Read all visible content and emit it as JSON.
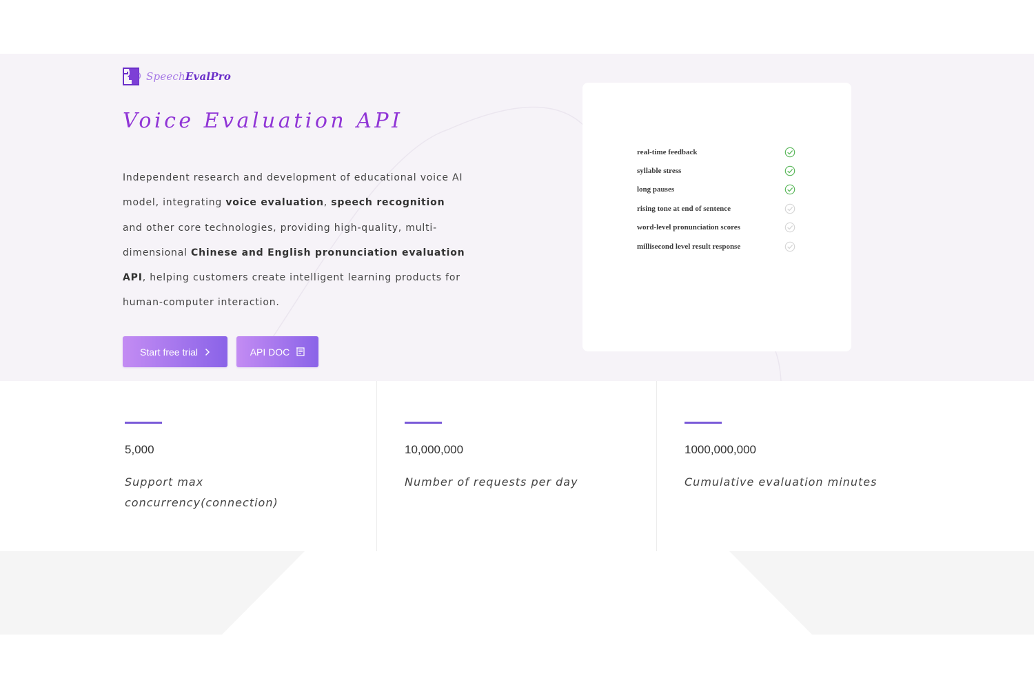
{
  "brand": {
    "name_part1": "Speech",
    "name_part2": "EvalPro",
    "logo_icon": "speaker-head-icon"
  },
  "hero": {
    "title": "Voice Evaluation API",
    "description": {
      "t1": "Independent research and development of educational voice AI model, integrating ",
      "b1": "voice evaluation",
      "t2": ", ",
      "b2": "speech recognition",
      "t3": " and other core technologies, providing high-quality, multi-dimensional ",
      "b3": "Chinese and English pronunciation evaluation API",
      "t4": ", helping customers create intelligent learning products for human-computer interaction."
    },
    "buttons": {
      "trial_label": "Start free trial",
      "trial_icon": "chevron-right-icon",
      "doc_label": "API DOC",
      "doc_icon": "document-icon"
    }
  },
  "features": [
    {
      "label": "real-time feedback",
      "checked": true
    },
    {
      "label": "syllable stress",
      "checked": true
    },
    {
      "label": "long pauses",
      "checked": true
    },
    {
      "label": "rising tone at end of sentence",
      "checked": false
    },
    {
      "label": "word-level pronunciation scores",
      "checked": false
    },
    {
      "label": "millisecond level result response",
      "checked": false
    }
  ],
  "stats": [
    {
      "value": "5,000",
      "caption": "Support max concurrency(connection)"
    },
    {
      "value": "10,000,000",
      "caption": "Number of requests per day"
    },
    {
      "value": "1000,000,000",
      "caption": "Cumulative evaluation minutes"
    }
  ],
  "colors": {
    "accent": "#9035d6",
    "button_start": "#c38cf3",
    "button_end": "#8a63e8",
    "check_active": "#5cb85c",
    "check_inactive": "#d6d6d6",
    "hero_bg": "#f6f3f8",
    "stat_bar": "#7a5ad8"
  }
}
